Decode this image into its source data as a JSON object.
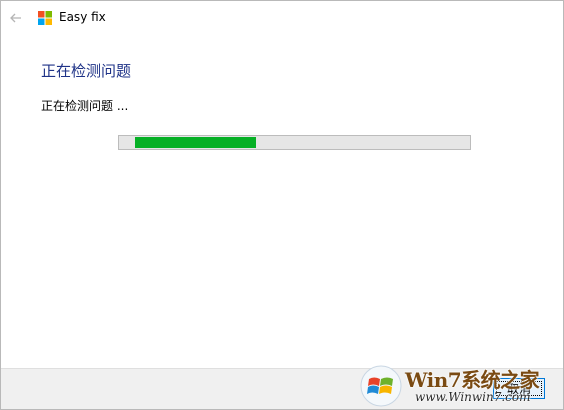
{
  "window": {
    "app_title": "Easy fix",
    "back_icon": "arrow-left-icon",
    "logo_icon": "windows-logo-icon"
  },
  "main": {
    "heading": "正在检测问题",
    "status": "正在检测问题 ...",
    "progress_fraction": 0.36
  },
  "footer": {
    "cancel_label": "取消"
  },
  "watermark": {
    "title": "Win7系统之家",
    "url": "www.Winwin7.com"
  },
  "colors": {
    "heading": "#1e3287",
    "progress": "#06b025",
    "button_border": "#0078d7"
  }
}
